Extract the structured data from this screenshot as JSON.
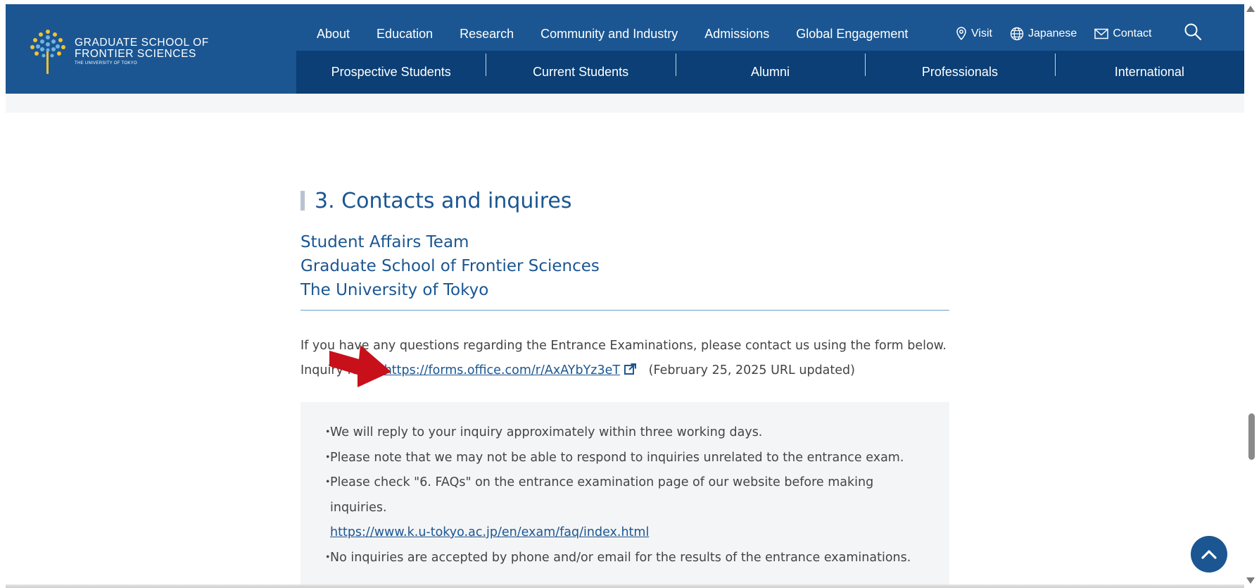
{
  "header": {
    "logo": {
      "line1": "GRADUATE SCHOOL OF",
      "line2": "FRONTIER SCIENCES",
      "line3": "THE UNIVERSITY OF TOKYO"
    },
    "topnav": [
      "About",
      "Education",
      "Research",
      "Community and Industry",
      "Admissions",
      "Global Engagement"
    ],
    "utilnav": {
      "visit": "Visit",
      "japanese": "Japanese",
      "contact": "Contact"
    },
    "search_icon": "search-icon",
    "subnav": [
      "Prospective Students",
      "Current Students",
      "Alumni",
      "Professionals",
      "International"
    ]
  },
  "section": {
    "title": "3. Contacts and inquires",
    "contact_lines": [
      "Student Affairs Team",
      "Graduate School of Frontier Sciences",
      "The University of Tokyo"
    ],
    "intro": "If you have any questions regarding the Entrance Examinations, please contact us using the form below.",
    "inquiry_label": "Inquiry form:",
    "inquiry_url": "https://forms.office.com/r/AxAYbYz3eT",
    "inquiry_note": "(February 25, 2025 URL updated)",
    "notes": [
      "We will reply to your inquiry approximately within three working days.",
      "Please note that we may not be able to respond to inquiries unrelated to the entrance exam.",
      "Please check \"6. FAQs\" on the entrance examination page of our website before making inquiries.",
      "No inquiries are accepted by phone and/or email for the results of the entrance examinations."
    ],
    "faq_url": "https://www.k.u-tokyo.ac.jp/en/exam/faq/index.html",
    "bullet": "・"
  },
  "colors": {
    "brand_blue": "#1b5692",
    "subnav_blue": "#0b3f75",
    "annotation_red": "#c8101a"
  }
}
